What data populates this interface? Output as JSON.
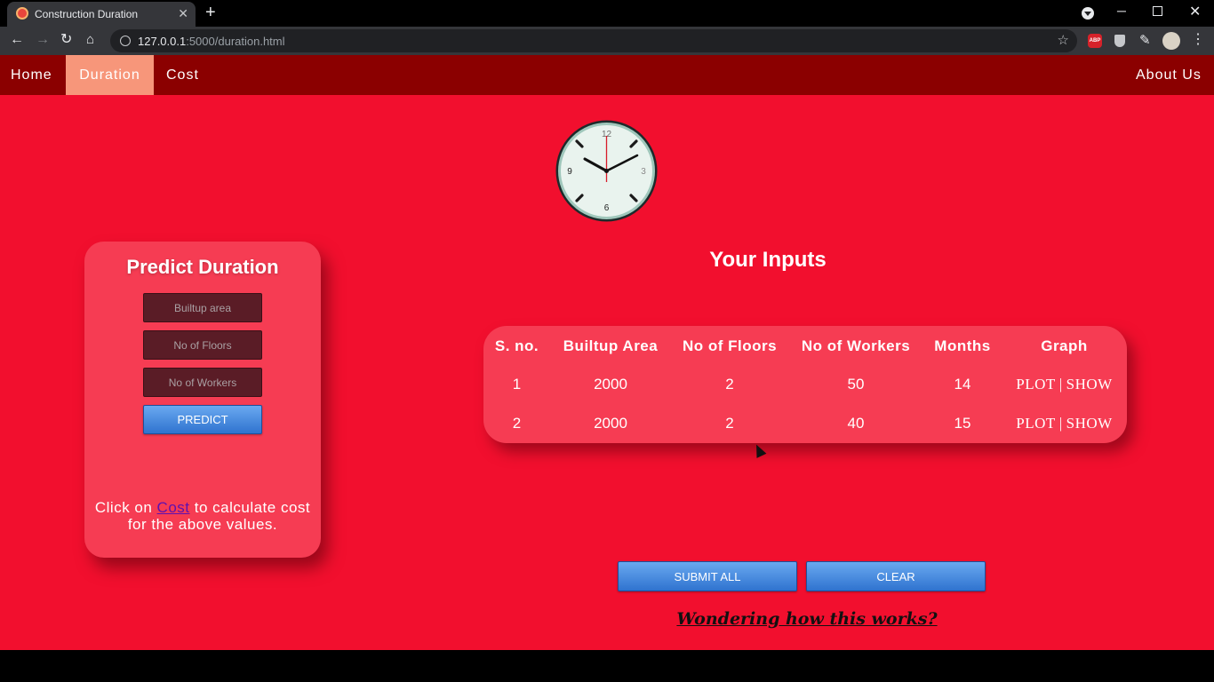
{
  "browser": {
    "tab_title": "Construction Duration",
    "tab_close": "✕",
    "new_tab": "+",
    "url_host": "127.0.0.1",
    "url_rest": ":5000/duration.html",
    "abp_label": "ABP",
    "window_min": "─",
    "window_close": "✕"
  },
  "nav": {
    "home": "Home",
    "duration": "Duration",
    "cost": "Cost",
    "about": "About Us",
    "active": "Duration"
  },
  "clock": {
    "numbers": [
      "12",
      "3",
      "6",
      "9"
    ]
  },
  "predict": {
    "title": "Predict Duration",
    "builtup_placeholder": "Builtup area",
    "floors_placeholder": "No of Floors",
    "workers_placeholder": "No of Workers",
    "button": "PREDICT",
    "note_before": "Click on ",
    "note_link": "Cost",
    "note_after": " to calculate cost for the above values."
  },
  "inputs": {
    "heading": "Your Inputs",
    "columns": [
      "S. no.",
      "Builtup Area",
      "No of Floors",
      "No of Workers",
      "Months",
      "Graph"
    ],
    "rows": [
      {
        "sno": "1",
        "area": "2000",
        "floors": "2",
        "workers": "50",
        "months": "14",
        "plot": "PLOT",
        "sep": "|",
        "show": "SHOW"
      },
      {
        "sno": "2",
        "area": "2000",
        "floors": "2",
        "workers": "40",
        "months": "15",
        "plot": "PLOT",
        "sep": "|",
        "show": "SHOW"
      }
    ]
  },
  "actions": {
    "submit_all": "SUBMIT ALL",
    "clear": "CLEAR",
    "how_link": "Wondering how this works?"
  },
  "colors": {
    "page_bg": "#f20f2e",
    "navbar_bg": "#8b0000",
    "active_nav": "#f7967a",
    "card_bg": "#f63c53",
    "button_blue": "#4a8fe0"
  }
}
